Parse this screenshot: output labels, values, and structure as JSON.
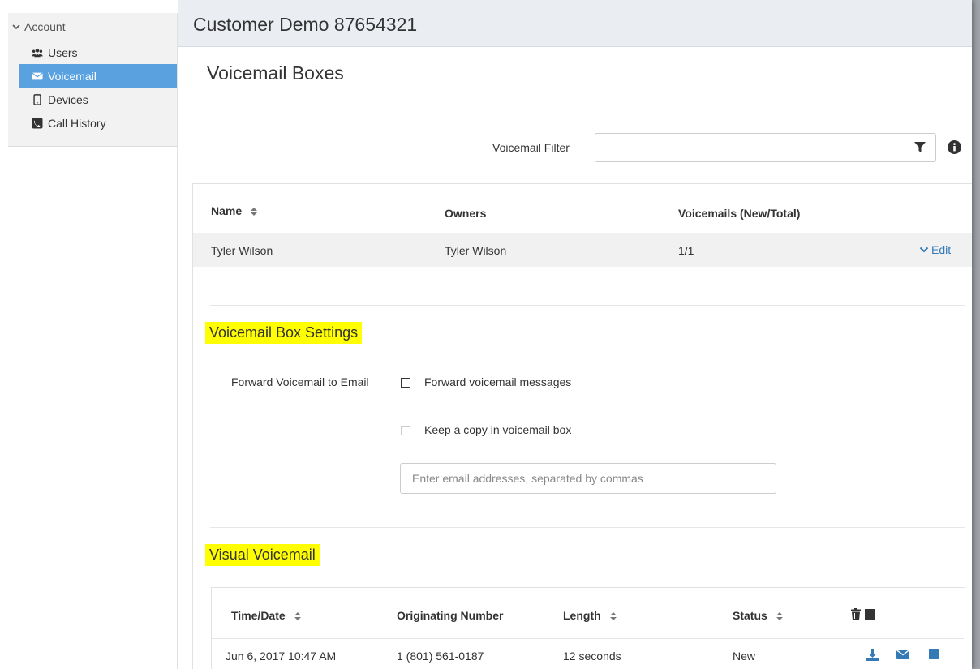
{
  "sidebar": {
    "heading": "Account",
    "items": [
      {
        "label": "Users",
        "icon": "users-icon"
      },
      {
        "label": "Voicemail",
        "icon": "envelope-icon",
        "active": true
      },
      {
        "label": "Devices",
        "icon": "phone-device-icon"
      },
      {
        "label": "Call History",
        "icon": "call-history-icon"
      }
    ]
  },
  "header": {
    "title": "Customer Demo 87654321"
  },
  "page": {
    "title": "Voicemail Boxes"
  },
  "filter": {
    "label": "Voicemail Filter",
    "value": ""
  },
  "boxes_table": {
    "columns": [
      "Name",
      "Owners",
      "Voicemails (New/Total)"
    ],
    "rows": [
      {
        "name": "Tyler Wilson",
        "owners": "Tyler Wilson",
        "voicemails": "1/1",
        "action": "Edit"
      }
    ]
  },
  "settings": {
    "heading": "Voicemail Box Settings",
    "forward_label": "Forward Voicemail to Email",
    "forward_option": "Forward voicemail messages",
    "keep_copy_option": "Keep a copy in voicemail box",
    "email_placeholder": "Enter email addresses, separated by commas"
  },
  "visual_voicemail": {
    "heading": "Visual Voicemail",
    "columns": [
      "Time/Date",
      "Originating Number",
      "Length",
      "Status"
    ],
    "rows": [
      {
        "time": "Jun 6, 2017 10:47 AM",
        "number": "1 (801) 561-0187",
        "length": "12 seconds",
        "status": "New"
      }
    ]
  },
  "colors": {
    "accent": "#5aa1e0",
    "link": "#337ab7",
    "highlight": "#ffff00",
    "header_bg": "#eaeef3"
  }
}
